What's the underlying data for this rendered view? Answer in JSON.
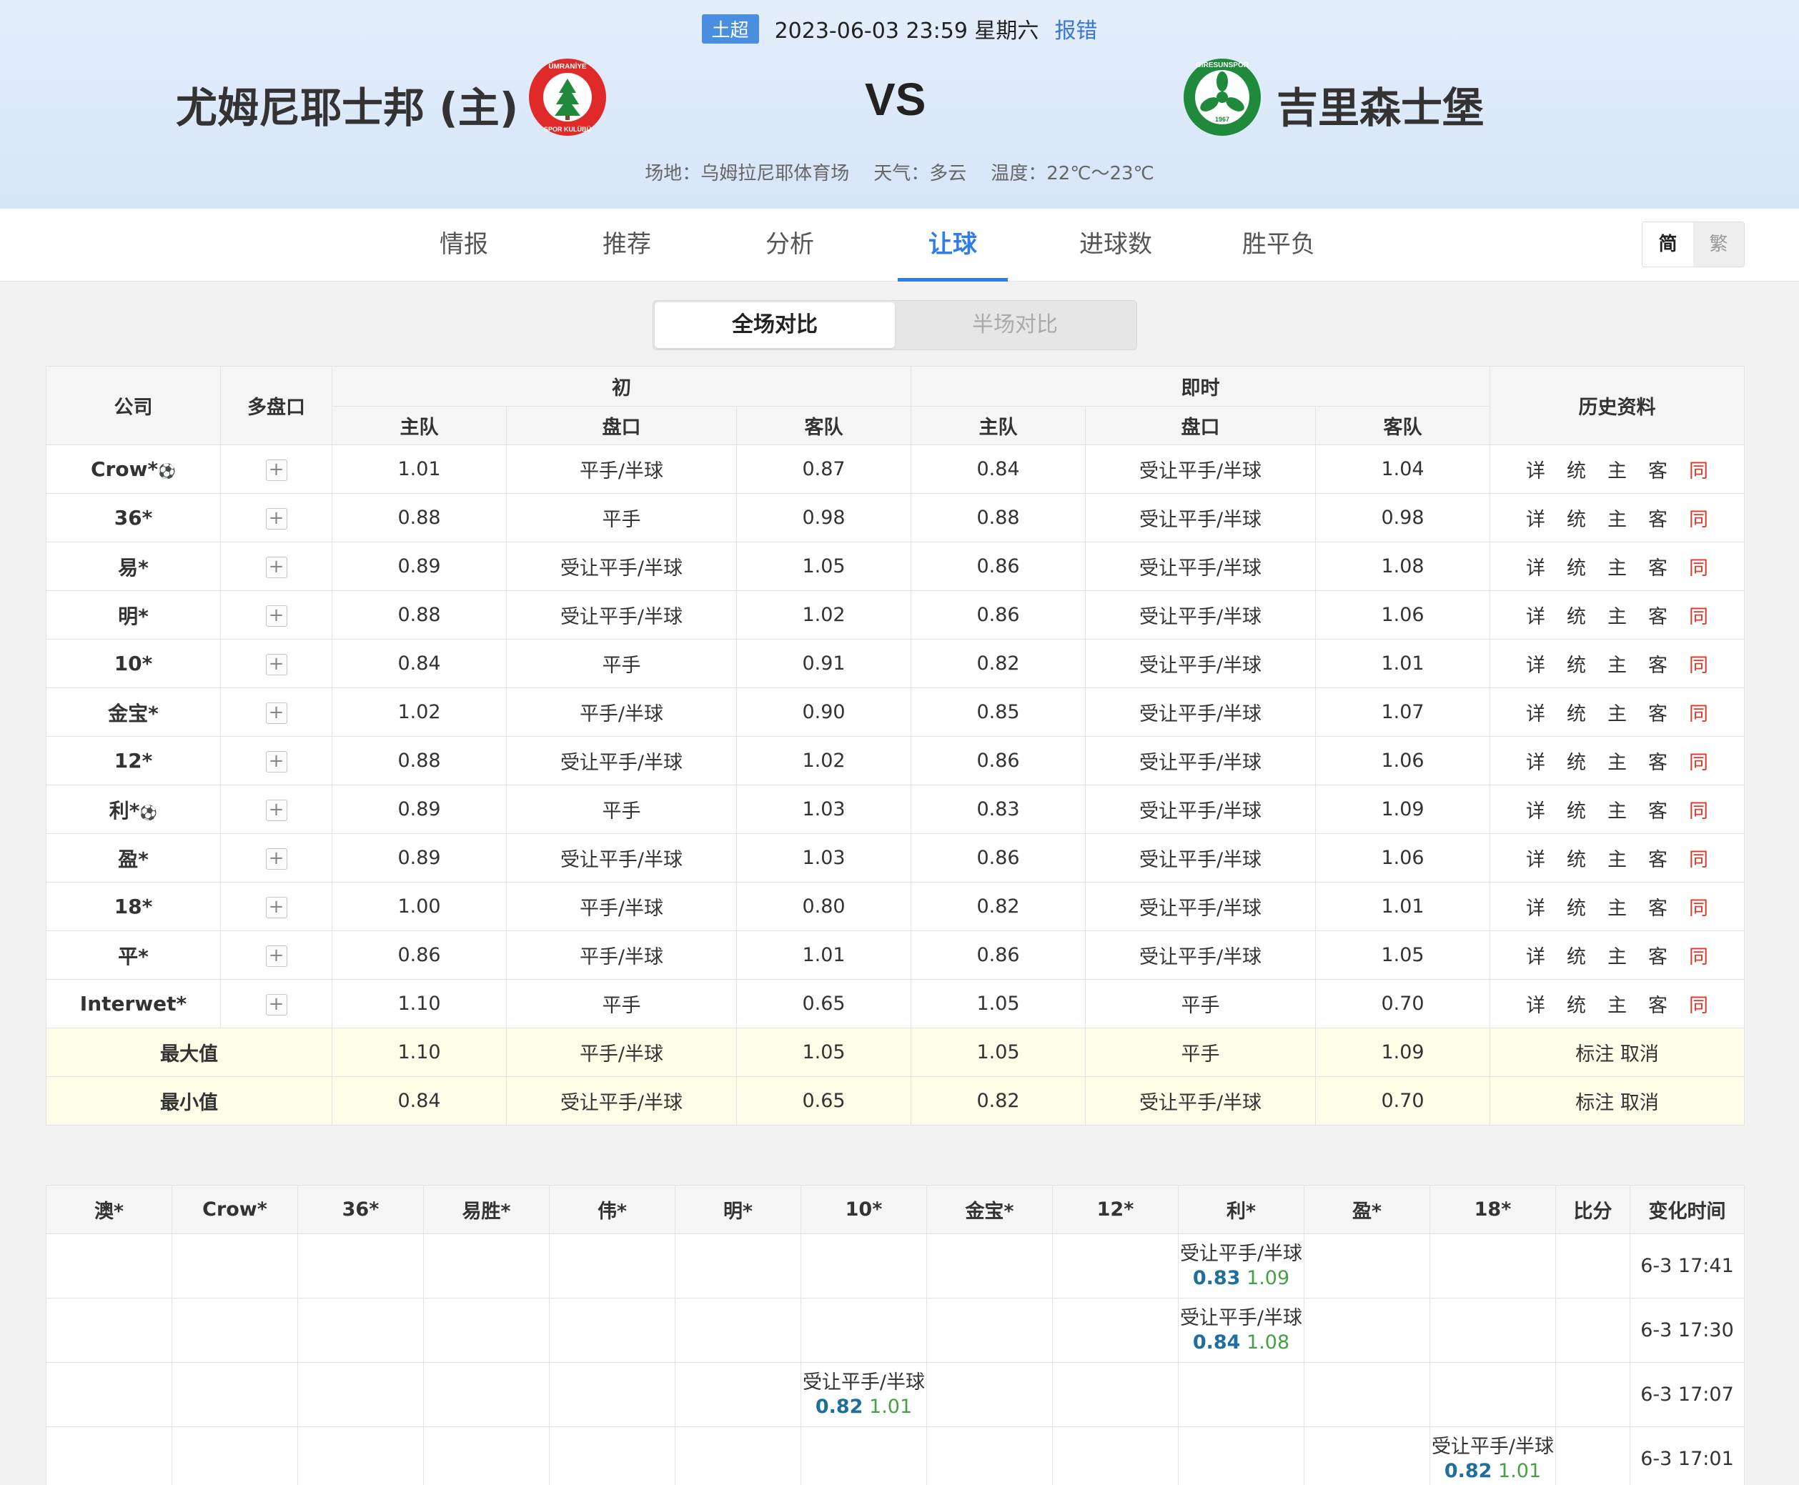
{
  "header": {
    "league": "土超",
    "datetime": "2023-06-03 23:59 星期六",
    "report_link": "报错",
    "home_team": "尤姆尼耶士邦 (主)",
    "away_team": "吉里森士堡",
    "vs": "VS",
    "venue": "场地：乌姆拉尼耶体育场",
    "weather": "天气：多云",
    "temperature": "温度：22℃～23℃",
    "home_logo_text": "ÜMRANİYE SPOR KULÜBÜ",
    "away_logo_text": "GIRESUNSPOR 1967"
  },
  "nav": {
    "tabs": [
      "情报",
      "推荐",
      "分析",
      "让球",
      "进球数",
      "胜平负"
    ],
    "active_index": 3,
    "lang": [
      "简",
      "繁"
    ]
  },
  "segment": {
    "full": "全场对比",
    "half": "半场对比"
  },
  "main_table": {
    "headers": {
      "company": "公司",
      "multi": "多盘口",
      "initial": "初",
      "live": "即时",
      "history": "历史资料",
      "home": "主队",
      "line": "盘口",
      "away": "客队"
    },
    "hist_links": [
      "详",
      "统",
      "主",
      "客",
      "同"
    ],
    "rows": [
      {
        "company": "Crow*",
        "ball": true,
        "i_home": "1.01",
        "i_line": "平手/半球",
        "i_away": "0.87",
        "l_home": "0.84",
        "l_line": "受让平手/半球",
        "l_away": "1.04"
      },
      {
        "company": "36*",
        "ball": false,
        "i_home": "0.88",
        "i_line": "平手",
        "i_away": "0.98",
        "l_home": "0.88",
        "l_line": "受让平手/半球",
        "l_away": "0.98"
      },
      {
        "company": "易*",
        "ball": false,
        "i_home": "0.89",
        "i_line": "受让平手/半球",
        "i_away": "1.05",
        "l_home": "0.86",
        "l_line": "受让平手/半球",
        "l_away": "1.08"
      },
      {
        "company": "明*",
        "ball": false,
        "i_home": "0.88",
        "i_line": "受让平手/半球",
        "i_away": "1.02",
        "l_home": "0.86",
        "l_line": "受让平手/半球",
        "l_away": "1.06"
      },
      {
        "company": "10*",
        "ball": false,
        "i_home": "0.84",
        "i_line": "平手",
        "i_away": "0.91",
        "l_home": "0.82",
        "l_line": "受让平手/半球",
        "l_away": "1.01"
      },
      {
        "company": "金宝*",
        "ball": false,
        "i_home": "1.02",
        "i_line": "平手/半球",
        "i_away": "0.90",
        "l_home": "0.85",
        "l_line": "受让平手/半球",
        "l_away": "1.07"
      },
      {
        "company": "12*",
        "ball": false,
        "i_home": "0.88",
        "i_line": "受让平手/半球",
        "i_away": "1.02",
        "l_home": "0.86",
        "l_line": "受让平手/半球",
        "l_away": "1.06"
      },
      {
        "company": "利*",
        "ball": true,
        "i_home": "0.89",
        "i_line": "平手",
        "i_away": "1.03",
        "l_home": "0.83",
        "l_line": "受让平手/半球",
        "l_away": "1.09"
      },
      {
        "company": "盈*",
        "ball": false,
        "i_home": "0.89",
        "i_line": "受让平手/半球",
        "i_away": "1.03",
        "l_home": "0.86",
        "l_line": "受让平手/半球",
        "l_away": "1.06"
      },
      {
        "company": "18*",
        "ball": false,
        "i_home": "1.00",
        "i_line": "平手/半球",
        "i_away": "0.80",
        "l_home": "0.82",
        "l_line": "受让平手/半球",
        "l_away": "1.01"
      },
      {
        "company": "平*",
        "ball": false,
        "i_home": "0.86",
        "i_line": "平手/半球",
        "i_away": "1.01",
        "l_home": "0.86",
        "l_line": "受让平手/半球",
        "l_away": "1.05"
      },
      {
        "company": "Interwet*",
        "ball": false,
        "i_home": "1.10",
        "i_line": "平手",
        "i_away": "0.65",
        "l_home": "1.05",
        "l_line": "平手",
        "l_away": "0.70"
      }
    ],
    "summary": [
      {
        "label": "最大值",
        "i_home": "1.10",
        "i_line": "平手/半球",
        "i_away": "1.05",
        "l_home": "1.05",
        "l_line": "平手",
        "l_away": "1.09",
        "action": "标注 取消"
      },
      {
        "label": "最小值",
        "i_home": "0.84",
        "i_line": "受让平手/半球",
        "i_away": "0.65",
        "l_home": "0.82",
        "l_line": "受让平手/半球",
        "l_away": "0.70",
        "action": "标注 取消"
      }
    ]
  },
  "history_table": {
    "headers": [
      "澳*",
      "Crow*",
      "36*",
      "易胜*",
      "伟*",
      "明*",
      "10*",
      "金宝*",
      "12*",
      "利*",
      "盈*",
      "18*",
      "比分",
      "变化时间"
    ],
    "rows": [
      {
        "col": 9,
        "line": "受让平手/半球",
        "home": "0.83",
        "away": "1.09",
        "time": "6-3 17:41"
      },
      {
        "col": 9,
        "line": "受让平手/半球",
        "home": "0.84",
        "away": "1.08",
        "time": "6-3 17:30"
      },
      {
        "col": 6,
        "line": "受让平手/半球",
        "home": "0.82",
        "away": "1.01",
        "time": "6-3 17:07"
      },
      {
        "col": 11,
        "line": "受让平手/半球",
        "home": "0.82",
        "away": "1.01",
        "time": "6-3 17:01"
      }
    ]
  },
  "colors": {
    "accent": "#2f7ee8",
    "league_badge": "#4a8ee0",
    "home_red": "#e02a2a",
    "away_green": "#1f8a3c",
    "same_link": "#e0362c",
    "summary_bg": "#fdfde8"
  }
}
